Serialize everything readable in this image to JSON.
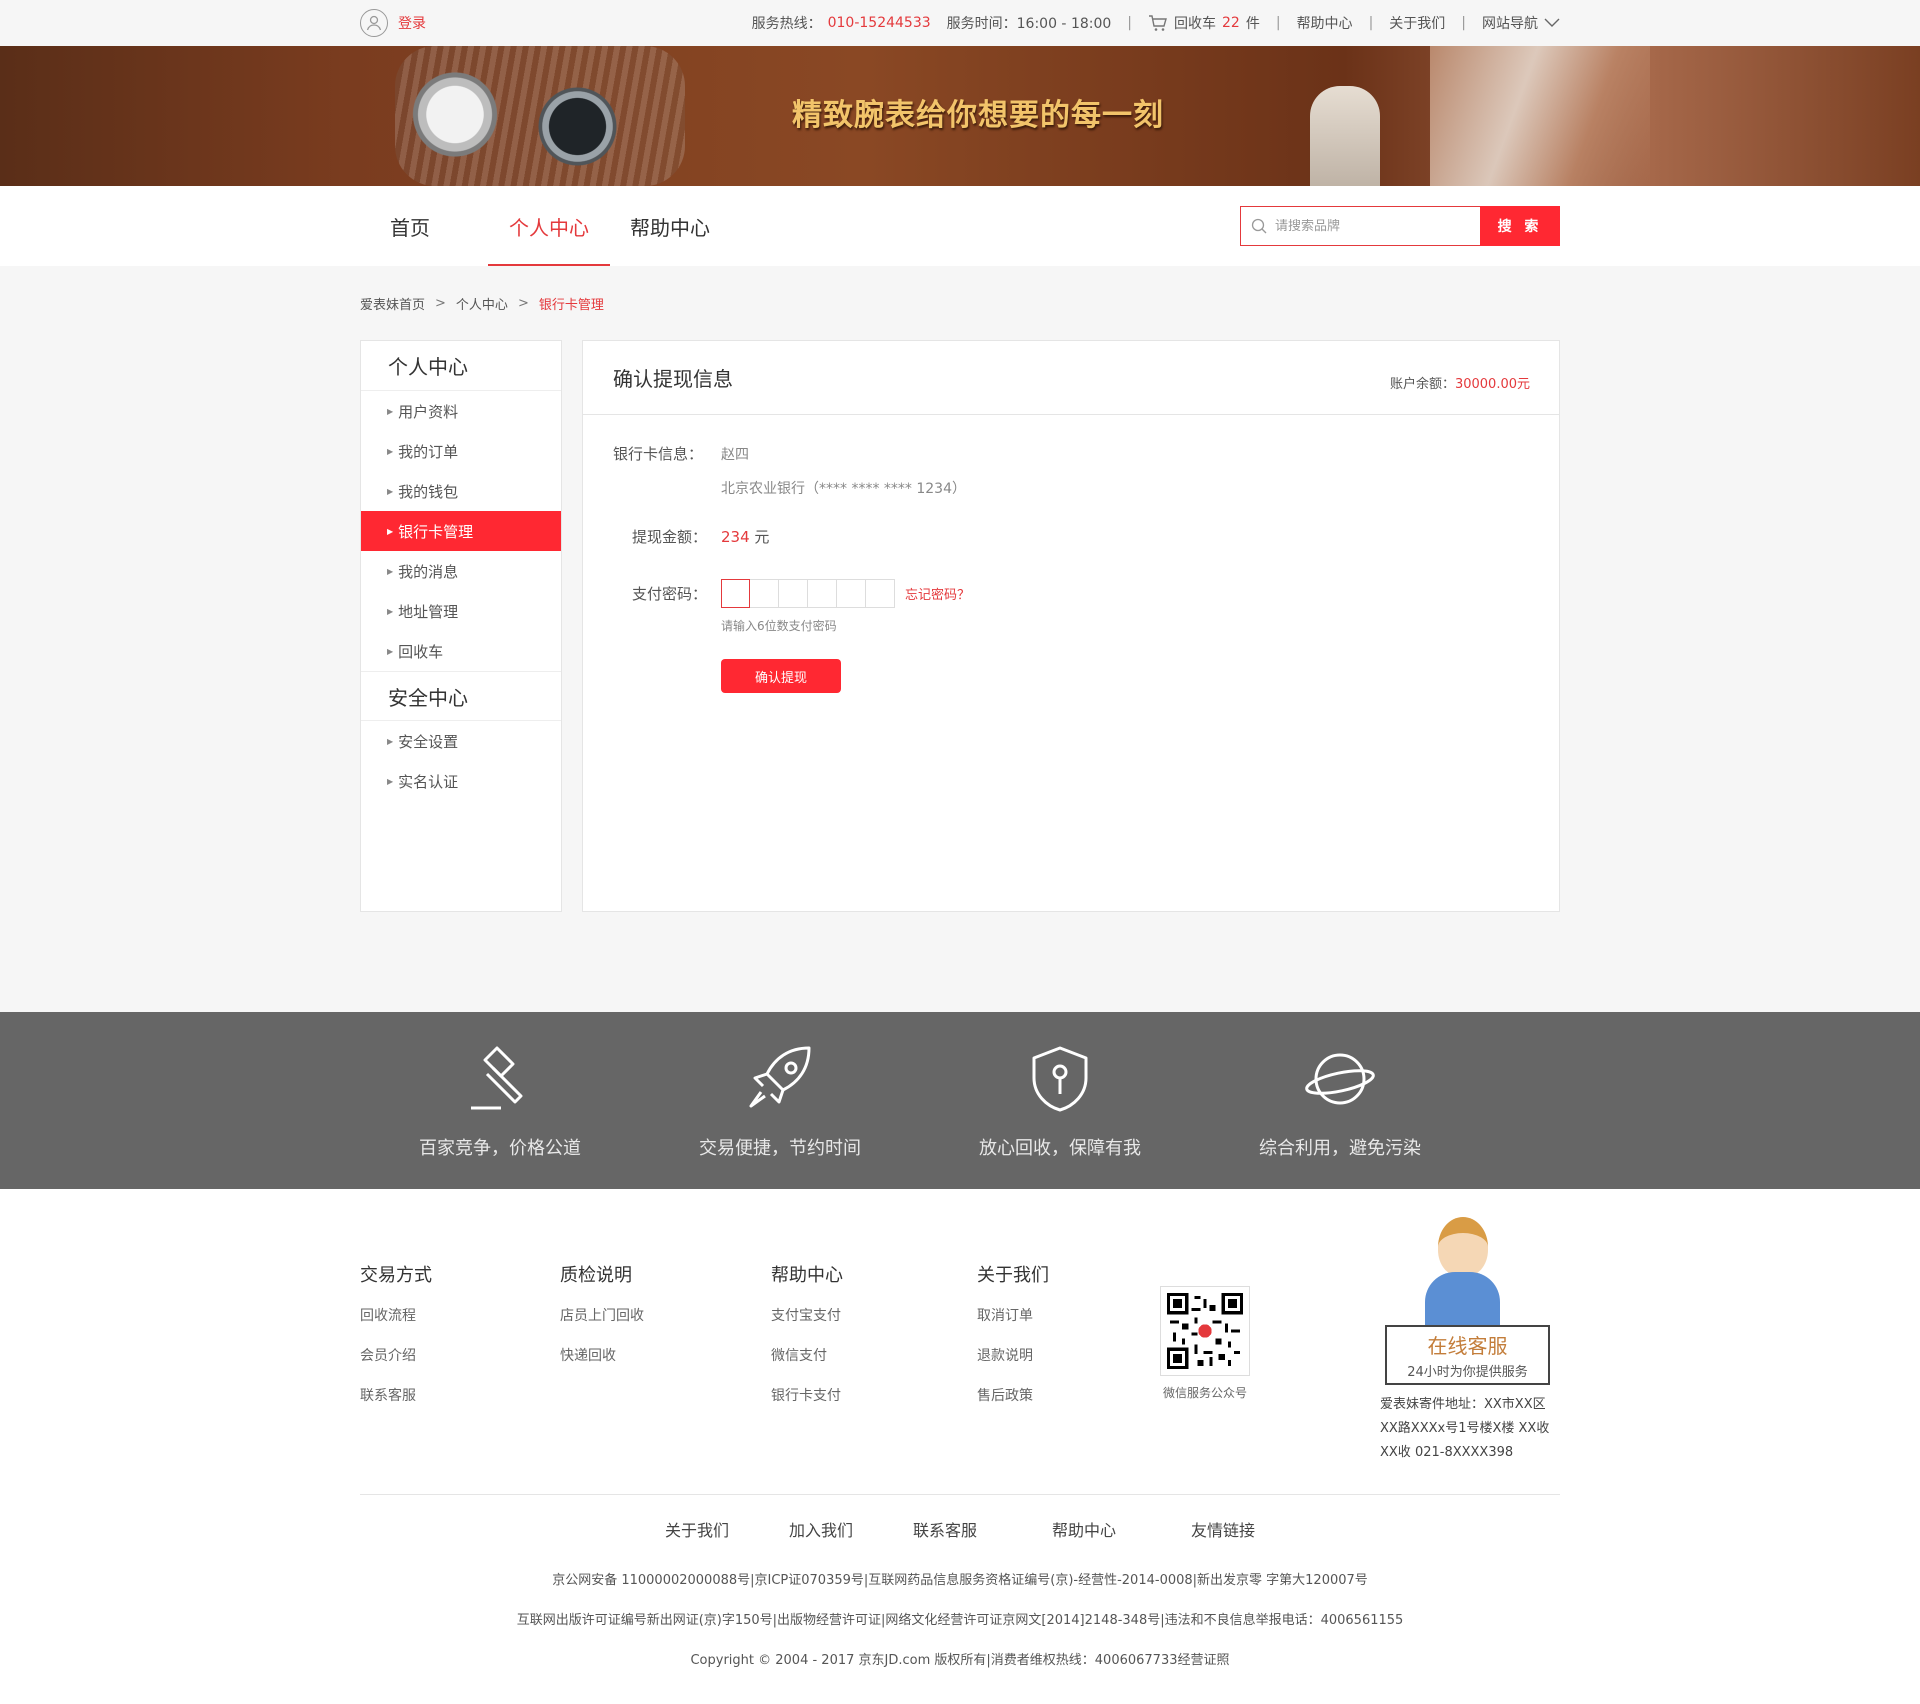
{
  "topbar": {
    "login": "登录",
    "hotline_label": "服务热线：",
    "hotline": "010-15244533",
    "hours": "服务时间：16:00 -  18:00",
    "cart_label": "回收车",
    "cart_count": "22",
    "cart_unit": "件",
    "help": "帮助中心",
    "about": "关于我们",
    "sitenav": "网站导航"
  },
  "banner": {
    "slogan": "精致腕表给你想要的每一刻"
  },
  "nav": {
    "items": [
      {
        "label": "首页"
      },
      {
        "label": "个人中心"
      },
      {
        "label": "帮助中心"
      }
    ],
    "search_placeholder": "请搜索品牌",
    "search_button": "搜 索"
  },
  "breadcrumb": {
    "home": "爱表妹首页",
    "center": "个人中心",
    "current": "银行卡管理"
  },
  "sidebar": {
    "group1_title": "个人中心",
    "group1_items": [
      {
        "label": "用户资料"
      },
      {
        "label": "我的订单"
      },
      {
        "label": "我的钱包"
      },
      {
        "label": "银行卡管理"
      },
      {
        "label": "我的消息"
      },
      {
        "label": "地址管理"
      },
      {
        "label": "回收车"
      }
    ],
    "group2_title": "安全中心",
    "group2_items": [
      {
        "label": "安全设置"
      },
      {
        "label": "实名认证"
      }
    ]
  },
  "content": {
    "title": "确认提现信息",
    "balance_label": "账户余额：",
    "balance": "30000.00元",
    "card_label": "银行卡信息：",
    "card_name": "赵四",
    "card_bank": "北京农业银行（**** **** **** 1234）",
    "amount_label": "提现金额：",
    "amount": "234",
    "amount_unit": " 元",
    "pwd_label": "支付密码：",
    "forgot": "忘记密码？",
    "hint": "请输入6位数支付密码",
    "confirm": "确认提现"
  },
  "features": [
    {
      "icon": "gavel-icon",
      "text": "百家竞争，价格公道"
    },
    {
      "icon": "rocket-icon",
      "text": "交易便捷，节约时间"
    },
    {
      "icon": "shield-icon",
      "text": "放心回收，保障有我"
    },
    {
      "icon": "planet-icon",
      "text": "综合利用，避免污染"
    }
  ],
  "footer": {
    "columns": [
      {
        "title": "交易方式",
        "links": [
          "回收流程",
          "会员介绍",
          "联系客服"
        ]
      },
      {
        "title": "质检说明",
        "links": [
          "店员上门回收",
          "快递回收"
        ]
      },
      {
        "title": "帮助中心",
        "links": [
          "支付宝支付",
          "微信支付",
          "银行卡支付"
        ]
      },
      {
        "title": "关于我们",
        "links": [
          "取消订单",
          "退款说明",
          "售后政策"
        ]
      }
    ],
    "qr_label": "微信服务公众号",
    "service_title": "在线客服",
    "service_sub": "24小时为你提供服务",
    "address": "爱表妹寄件地址：XX市XX区XX路XXXx号1号楼X楼 XX收XX收 021-8XXXX398",
    "bottom_links": [
      "关于我们",
      "加入我们",
      "联系客服",
      "帮助中心",
      "友情链接"
    ],
    "legal1": "京公网安备 11000002000088号|京ICP证070359号|互联网药品信息服务资格证编号(京)-经营性-2014-0008|新出发京零 字第大120007号",
    "legal2": "互联网出版许可证编号新出网证(京)字150号|出版物经营许可证|网络文化经营许可证京网文[2014]2148-348号|违法和不良信息举报电话：4006561155",
    "legal3": "Copyright © 2004 - 2017  京东JD.com 版权所有|消费者维权热线：4006067733经营证照"
  },
  "colors": {
    "accent": "#e4393c",
    "button": "#ff2832",
    "feature_band": "#666666"
  }
}
